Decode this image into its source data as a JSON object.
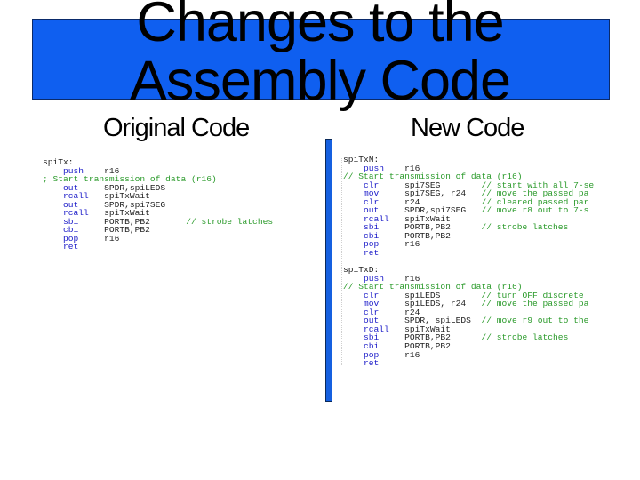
{
  "slide": {
    "title_line1": "Changes to the",
    "title_line2": "Assembly Code",
    "left_heading": "Original Code",
    "right_heading": "New Code",
    "colors": {
      "banner": "#0f5ff0",
      "divider": "#1560e0",
      "keyword": "#1a1ac8",
      "comment": "#2a9a2a"
    }
  },
  "original_code": [
    {
      "label": "spiTx:"
    },
    {
      "op": "push",
      "args": "r16",
      "comment": ""
    },
    {
      "line_comment": "; Start transmission of data (r16)"
    },
    {
      "op": "out",
      "args": "SPDR,spiLEDS",
      "comment": ""
    },
    {
      "op": "rcall",
      "args": "spiTxWait",
      "comment": ""
    },
    {
      "op": "out",
      "args": "SPDR,spi7SEG",
      "comment": ""
    },
    {
      "op": "rcall",
      "args": "spiTxWait",
      "comment": ""
    },
    {
      "op": "sbi",
      "args": "PORTB,PB2",
      "comment": "// strobe latches"
    },
    {
      "op": "cbi",
      "args": "PORTB,PB2",
      "comment": ""
    },
    {
      "op": "pop",
      "args": "r16",
      "comment": ""
    },
    {
      "op": "ret",
      "args": "",
      "comment": ""
    }
  ],
  "new_code": [
    {
      "label": "spiTxN:"
    },
    {
      "op": "push",
      "args": "r16",
      "comment": ""
    },
    {
      "line_comment": "// Start transmission of data (r16)"
    },
    {
      "op": "clr",
      "args": "spi7SEG",
      "comment": "// start with all 7-se"
    },
    {
      "op": "mov",
      "args": "spi7SEG, r24",
      "comment": "// move the passed pa"
    },
    {
      "op": "clr",
      "args": "r24",
      "comment": "// cleared passed par"
    },
    {
      "op": "out",
      "args": "SPDR,spi7SEG",
      "comment": "// move r8 out to 7-s"
    },
    {
      "op": "rcall",
      "args": "spiTxWait",
      "comment": ""
    },
    {
      "op": "sbi",
      "args": "PORTB,PB2",
      "comment": "// strobe latches"
    },
    {
      "op": "cbi",
      "args": "PORTB,PB2",
      "comment": ""
    },
    {
      "op": "pop",
      "args": "r16",
      "comment": ""
    },
    {
      "op": "ret",
      "args": "",
      "comment": ""
    },
    {
      "gap": true
    },
    {
      "label": "spiTxD:"
    },
    {
      "op": "push",
      "args": "r16",
      "comment": ""
    },
    {
      "line_comment": "// Start transmission of data (r16)"
    },
    {
      "op": "clr",
      "args": "spiLEDS",
      "comment": "// turn OFF discrete"
    },
    {
      "op": "mov",
      "args": "spiLEDS, r24",
      "comment": "// move the passed pa"
    },
    {
      "op": "clr",
      "args": "r24",
      "comment": ""
    },
    {
      "op": "out",
      "args": "SPDR, spiLEDS",
      "comment": "// move r9 out to the"
    },
    {
      "op": "rcall",
      "args": "spiTxWait",
      "comment": ""
    },
    {
      "op": "sbi",
      "args": "PORTB,PB2",
      "comment": "// strobe latches"
    },
    {
      "op": "cbi",
      "args": "PORTB,PB2",
      "comment": ""
    },
    {
      "op": "pop",
      "args": "r16",
      "comment": ""
    },
    {
      "op": "ret",
      "args": "",
      "comment": ""
    }
  ]
}
